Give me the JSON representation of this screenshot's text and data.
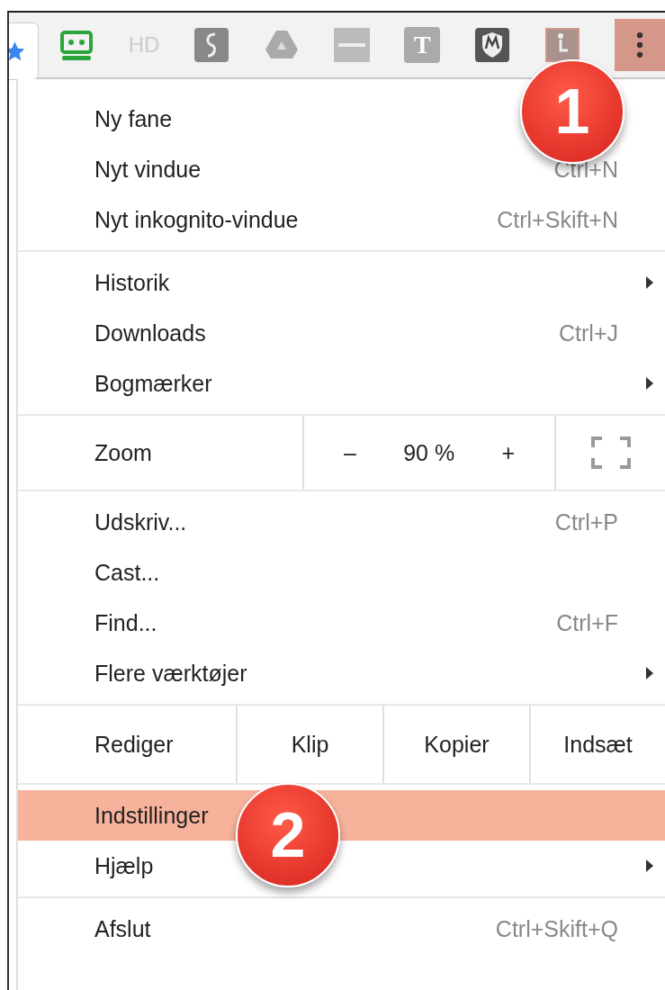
{
  "toolbar": {
    "icons": [
      {
        "kind": "star"
      },
      {
        "kind": "cassette"
      },
      {
        "kind": "text",
        "label": "HD"
      },
      {
        "kind": "s-logo"
      },
      {
        "kind": "triangle"
      },
      {
        "kind": "banner"
      },
      {
        "kind": "letter",
        "label": "T"
      },
      {
        "kind": "shield"
      },
      {
        "kind": "figure"
      }
    ],
    "menu_button": {
      "highlighted": true
    }
  },
  "menu": {
    "sections": [
      {
        "rows": [
          {
            "kind": "item",
            "label": "Ny fane",
            "selected": false
          },
          {
            "kind": "item",
            "label": "Nyt vindue",
            "shortcut": "Ctrl+N",
            "selected": false
          },
          {
            "kind": "item",
            "label": "Nyt inkognito-vindue",
            "shortcut": "Ctrl+Skift+N",
            "selected": false
          }
        ]
      },
      {
        "rows": [
          {
            "kind": "item",
            "label": "Historik",
            "submenu": true,
            "selected": false
          },
          {
            "kind": "item",
            "label": "Downloads",
            "shortcut": "Ctrl+J",
            "selected": false
          },
          {
            "kind": "item",
            "label": "Bogmærker",
            "submenu": true,
            "selected": false
          }
        ]
      },
      {
        "rows": [
          {
            "kind": "zoom",
            "label": "Zoom",
            "minus": "–",
            "value": "90 %",
            "plus": "+"
          }
        ]
      },
      {
        "rows": [
          {
            "kind": "item",
            "label": "Udskriv...",
            "shortcut": "Ctrl+P",
            "selected": false
          },
          {
            "kind": "item",
            "label": "Cast...",
            "selected": false
          },
          {
            "kind": "item",
            "label": "Find...",
            "shortcut": "Ctrl+F",
            "selected": false
          },
          {
            "kind": "item",
            "label": "Flere værktøjer",
            "submenu": true,
            "selected": false
          }
        ]
      },
      {
        "rows": [
          {
            "kind": "edit",
            "label": "Rediger",
            "buttons": [
              "Klip",
              "Kopier",
              "Indsæt"
            ]
          }
        ]
      },
      {
        "rows": [
          {
            "kind": "item",
            "label": "Indstillinger",
            "selected": true
          },
          {
            "kind": "item",
            "label": "Hjælp",
            "submenu": true,
            "selected": false
          }
        ]
      },
      {
        "rows": [
          {
            "kind": "item",
            "label": "Afslut",
            "shortcut": "Ctrl+Skift+Q",
            "selected": false
          }
        ]
      }
    ]
  },
  "callouts": [
    {
      "number": "1"
    },
    {
      "number": "2"
    }
  ]
}
